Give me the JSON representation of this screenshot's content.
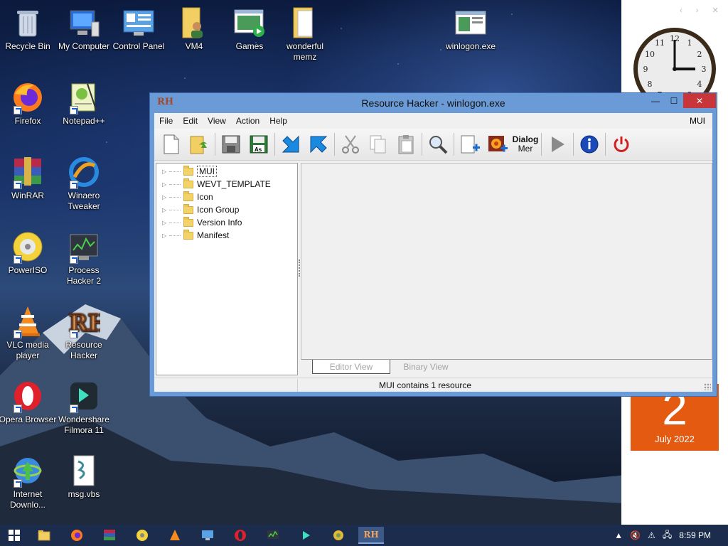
{
  "desktop": {
    "icons": [
      {
        "label": "Recycle Bin",
        "icon": "recycle-bin-icon"
      },
      {
        "label": "My Computer",
        "icon": "computer-icon"
      },
      {
        "label": "Control Panel",
        "icon": "control-panel-icon"
      },
      {
        "label": "VM4",
        "icon": "user-folder-icon"
      },
      {
        "label": "Games",
        "icon": "games-icon"
      },
      {
        "label": "wonderful memz",
        "icon": "folder-icon"
      },
      {
        "label": "winlogon.exe",
        "icon": "exe-window-icon"
      },
      {
        "label": "Firefox",
        "icon": "firefox-icon"
      },
      {
        "label": "Notepad++",
        "icon": "notepadpp-icon"
      },
      {
        "label": "WinRAR",
        "icon": "winrar-icon"
      },
      {
        "label": "Winaero Tweaker",
        "icon": "winaero-icon"
      },
      {
        "label": "PowerISO",
        "icon": "poweriso-icon"
      },
      {
        "label": "Process Hacker 2",
        "icon": "process-hacker-icon"
      },
      {
        "label": "VLC media player",
        "icon": "vlc-icon"
      },
      {
        "label": "Resource Hacker",
        "icon": "resource-hacker-icon"
      },
      {
        "label": "Opera Browser",
        "icon": "opera-icon"
      },
      {
        "label": "Wondershare Filmora 11",
        "icon": "filmora-icon"
      },
      {
        "label": "Internet Downlo...",
        "icon": "idm-icon"
      },
      {
        "label": "msg.vbs",
        "icon": "vbs-script-icon"
      }
    ]
  },
  "calendar": {
    "day": "2",
    "month_year": "July 2022",
    "color": "#e35a10"
  },
  "window": {
    "logo": "RH",
    "title": "Resource Hacker - winlogon.exe",
    "controls": {
      "minimize": "—",
      "maximize": "☐",
      "close": "✕"
    },
    "menu": [
      "File",
      "Edit",
      "View",
      "Action",
      "Help"
    ],
    "menu_right": "MUI",
    "toolbar": {
      "dialog_merge_label_1": "Dialog",
      "dialog_merge_label_2": "Mer"
    },
    "tree": [
      {
        "label": "MUI",
        "selected": true
      },
      {
        "label": "WEVT_TEMPLATE",
        "selected": false
      },
      {
        "label": "Icon",
        "selected": false
      },
      {
        "label": "Icon Group",
        "selected": false
      },
      {
        "label": "Version Info",
        "selected": false
      },
      {
        "label": "Manifest",
        "selected": false
      }
    ],
    "tabs": {
      "editor": "Editor View",
      "binary": "Binary View"
    },
    "status": "MUI contains 1 resource",
    "title_bar_color": "#6b9bd6",
    "close_color": "#c8363a"
  },
  "taskbar": {
    "clock": "8:59 PM",
    "apps": [
      "start-icon",
      "file-explorer-icon",
      "firefox-icon",
      "winrar-icon",
      "poweriso-icon",
      "vlc-icon",
      "control-panel-icon",
      "opera-icon",
      "process-hacker-icon",
      "filmora-icon",
      "network-icon",
      "resource-hacker-icon"
    ]
  }
}
